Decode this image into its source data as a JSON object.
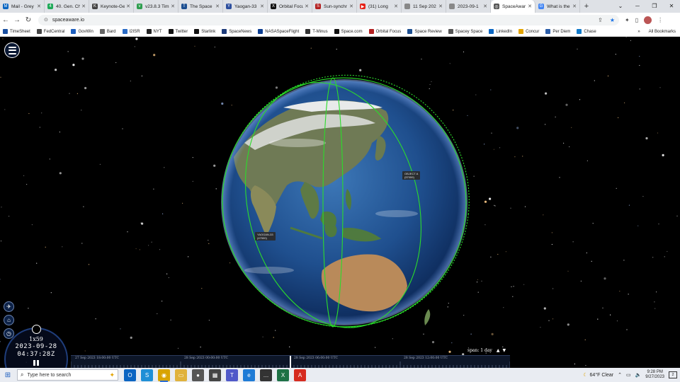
{
  "browser": {
    "tabs": [
      {
        "title": "Mail - Grey",
        "color": "#0a66c2",
        "icon": "M"
      },
      {
        "title": "40. Gen. Ch",
        "color": "#1faa59",
        "icon": "4"
      },
      {
        "title": "Keynote-Ge",
        "color": "#444444",
        "icon": "K"
      },
      {
        "title": "v23.8.3 Tim",
        "color": "#2e9e4f",
        "icon": "v"
      },
      {
        "title": "The Space",
        "color": "#1d4f91",
        "icon": "T"
      },
      {
        "title": "Yaogan-33",
        "color": "#2d4f9e",
        "icon": "Y"
      },
      {
        "title": "Orbital Focu",
        "color": "#111111",
        "icon": "X"
      },
      {
        "title": "Sun-synchr",
        "color": "#b32020",
        "icon": "S"
      },
      {
        "title": "(31) Long",
        "color": "#e62117",
        "icon": "▶"
      },
      {
        "title": "11 Sep 202",
        "color": "#888888",
        "icon": ""
      },
      {
        "title": "2023-09-1",
        "color": "#888888",
        "icon": ""
      },
      {
        "title": "SpaceAwar",
        "color": "#555555",
        "icon": "◎",
        "active": true
      },
      {
        "title": "What is the",
        "color": "#4285f4",
        "icon": "G"
      }
    ],
    "new_tab": "+",
    "window_controls": [
      "⌄",
      "─",
      "❐",
      "✕"
    ],
    "url": "spaceaware.io",
    "bookmarks": [
      {
        "label": "TimeSheet",
        "color": "#1a4fa0"
      },
      {
        "label": "FedCentral",
        "color": "#444444"
      },
      {
        "label": "GovWin",
        "color": "#1d5fbf"
      },
      {
        "label": "Bard",
        "color": "#666666"
      },
      {
        "label": "I2ISR",
        "color": "#2a6cc6"
      },
      {
        "label": "NYT",
        "color": "#222222"
      },
      {
        "label": "Twitter",
        "color": "#111111"
      },
      {
        "label": "Starlink",
        "color": "#111111"
      },
      {
        "label": "SpaceNews",
        "color": "#1d3b7a"
      },
      {
        "label": "NASASpaceFlight",
        "color": "#0b3d91"
      },
      {
        "label": "T-Minus",
        "color": "#333333"
      },
      {
        "label": "Space.com",
        "color": "#111111"
      },
      {
        "label": "Orbital Focus",
        "color": "#b32020"
      },
      {
        "label": "Space Review",
        "color": "#1d4f91"
      },
      {
        "label": "Spacey Space",
        "color": "#555555"
      },
      {
        "label": "LinkedIn",
        "color": "#0a66c2"
      },
      {
        "label": "Concur",
        "color": "#e3a400"
      },
      {
        "label": "Per Diem",
        "color": "#2b5da8"
      },
      {
        "label": "Chase",
        "color": "#117aca"
      }
    ],
    "more_bookmarks": "»",
    "all_bookmarks": "All Bookmarks"
  },
  "app": {
    "labels": {
      "object_a": {
        "name": "OBJECT A",
        "id": "(57059)"
      },
      "yaogan": {
        "name": "YAOGAN-33",
        "id": "(47500)"
      }
    },
    "clock": {
      "speed": "1x59",
      "date": "2023-09-28",
      "time": "04:37:28Z"
    },
    "timeline": {
      "labels": [
        "27 Sep 2023 18:00:00 UTC",
        "28 Sep 2023 00:00:00 UTC",
        "28 Sep 2023 06:00:00 UTC",
        "28 Sep 2023 12:00:00 UTC"
      ],
      "span_label": "span: 1 day",
      "span_up": "▲",
      "span_down": "▼"
    },
    "orbit_color": "#2bdc2b"
  },
  "taskbar": {
    "search_placeholder": "Type here to search",
    "apps": [
      {
        "name": "outlook",
        "color": "#0a64c2",
        "glyph": "O"
      },
      {
        "name": "skype",
        "color": "#1f8fd6",
        "glyph": "S"
      },
      {
        "name": "chrome",
        "color": "#d9a400",
        "glyph": "◉",
        "active": true
      },
      {
        "name": "files",
        "color": "#e0b23c",
        "glyph": "▭"
      },
      {
        "name": "store",
        "color": "#555555",
        "glyph": "●"
      },
      {
        "name": "calculator",
        "color": "#444444",
        "glyph": "▦"
      },
      {
        "name": "teams",
        "color": "#5059c9",
        "glyph": "T"
      },
      {
        "name": "edge",
        "color": "#1e7bd6",
        "glyph": "e"
      },
      {
        "name": "chat",
        "color": "#333333",
        "glyph": "…"
      },
      {
        "name": "excel",
        "color": "#1e7145",
        "glyph": "X"
      },
      {
        "name": "acrobat",
        "color": "#d62b1f",
        "glyph": "A"
      }
    ],
    "weather": "64°F  Clear",
    "time": "9:28 PM",
    "date": "9/27/2023",
    "notifications": "2"
  }
}
